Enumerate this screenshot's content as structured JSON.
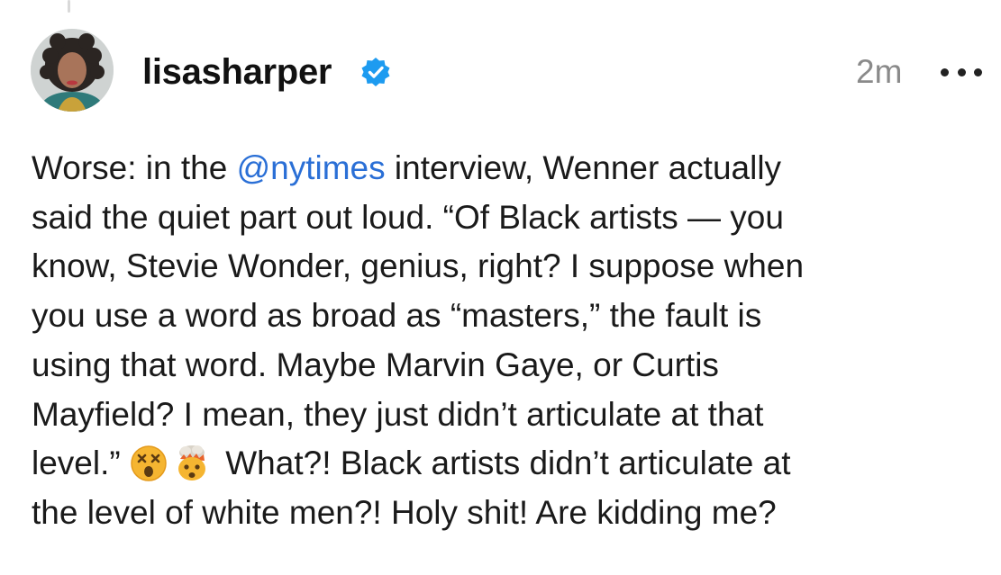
{
  "post": {
    "username": "lisasharper",
    "verified": true,
    "timestamp": "2m",
    "avatar_icon": "avatar-photo",
    "more_icon": "more-options-icon",
    "body": {
      "line1_a": "Worse: in the ",
      "line1_mention": "@nytimes",
      "line1_b": " interview, Wenner actually",
      "line2": "said the quiet part out loud. “Of Black artists — you",
      "line3": "know, Stevie Wonder, genius, right? I suppose when",
      "line4": "you use a word as broad as “masters,” the fault is",
      "line5": "using that word. Maybe Marvin Gaye, or Curtis",
      "line6": "Mayfield? I mean, they just didn’t articulate at that",
      "line7_a": "level.” ",
      "line7_b": " What?! Black artists didn’t articulate at",
      "line8": "the level of white men?! Holy shit! Are kidding me?"
    },
    "emojis": [
      "dizzy-face-emoji",
      "exploding-head-emoji"
    ]
  },
  "colors": {
    "mention": "#2a6fd6",
    "verified": "#1d9bf0",
    "timestamp": "#8a8a8a"
  }
}
